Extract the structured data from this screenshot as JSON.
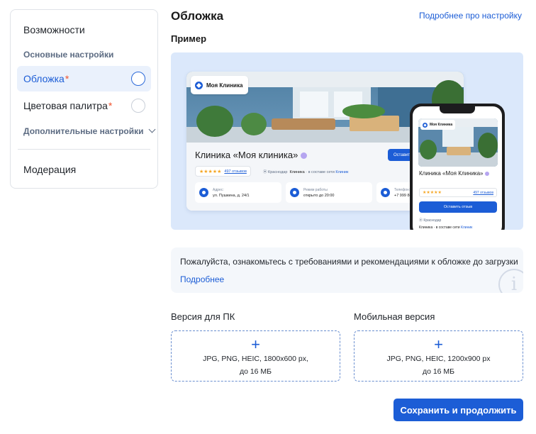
{
  "sidebar": {
    "features": "Возможности",
    "basic_settings": "Основные настройки",
    "cover": "Обложка",
    "palette": "Цветовая палитра",
    "required_mark": "*",
    "extra_settings": "Дополнительные настройки",
    "moderation": "Модерация"
  },
  "header": {
    "title": "Обложка",
    "more_link": "Подробнее про настройку"
  },
  "example": {
    "label": "Пример",
    "desktop": {
      "logo": "Моя Клиника",
      "clinic_name": "Клиника «Моя клиника»",
      "leave_review": "Оставить отзыв",
      "reviews": "497 отзывов",
      "city": "Краснодар",
      "clinic": "Клиника",
      "network_prefix": "· в составе сети",
      "network": "Клиник",
      "address_label": "Адрес:",
      "address_value": "ул. Пушкина, д. 24/1",
      "hours_label": "Режим работы",
      "hours_value": "открыто до 20:00",
      "phone_label": "Телефон:",
      "phone_value": "+7 999 888"
    },
    "mobile": {
      "logo": "Моя Клиника",
      "clinic_name": "Клиника «Моя Клиника»",
      "reviews": "497 отзывов",
      "leave_review": "Оставить отзыв",
      "city": "Краснодар",
      "clinic": "Клиника",
      "network_prefix": "· в составе сети",
      "network": "Клиник"
    }
  },
  "notice": {
    "text": "Пожалуйста, ознакомьтесь с требованиями и рекомендациями к обложке до загрузки",
    "link": "Подробнее"
  },
  "uploads": {
    "desktop_label": "Версия для ПК",
    "desktop_formats": "JPG, PNG, HEIC, 1800x600 px,",
    "desktop_size": "до 16 МБ",
    "mobile_label": "Мобильная версия",
    "mobile_formats": "JPG, PNG, HEIC, 1200x900 px",
    "mobile_size": "до 16 МБ",
    "plus": "+"
  },
  "actions": {
    "save": "Сохранить и продолжить"
  },
  "colors": {
    "accent": "#1c5dd6",
    "required": "#f0532e",
    "preview_bg": "#dbe8fb"
  }
}
